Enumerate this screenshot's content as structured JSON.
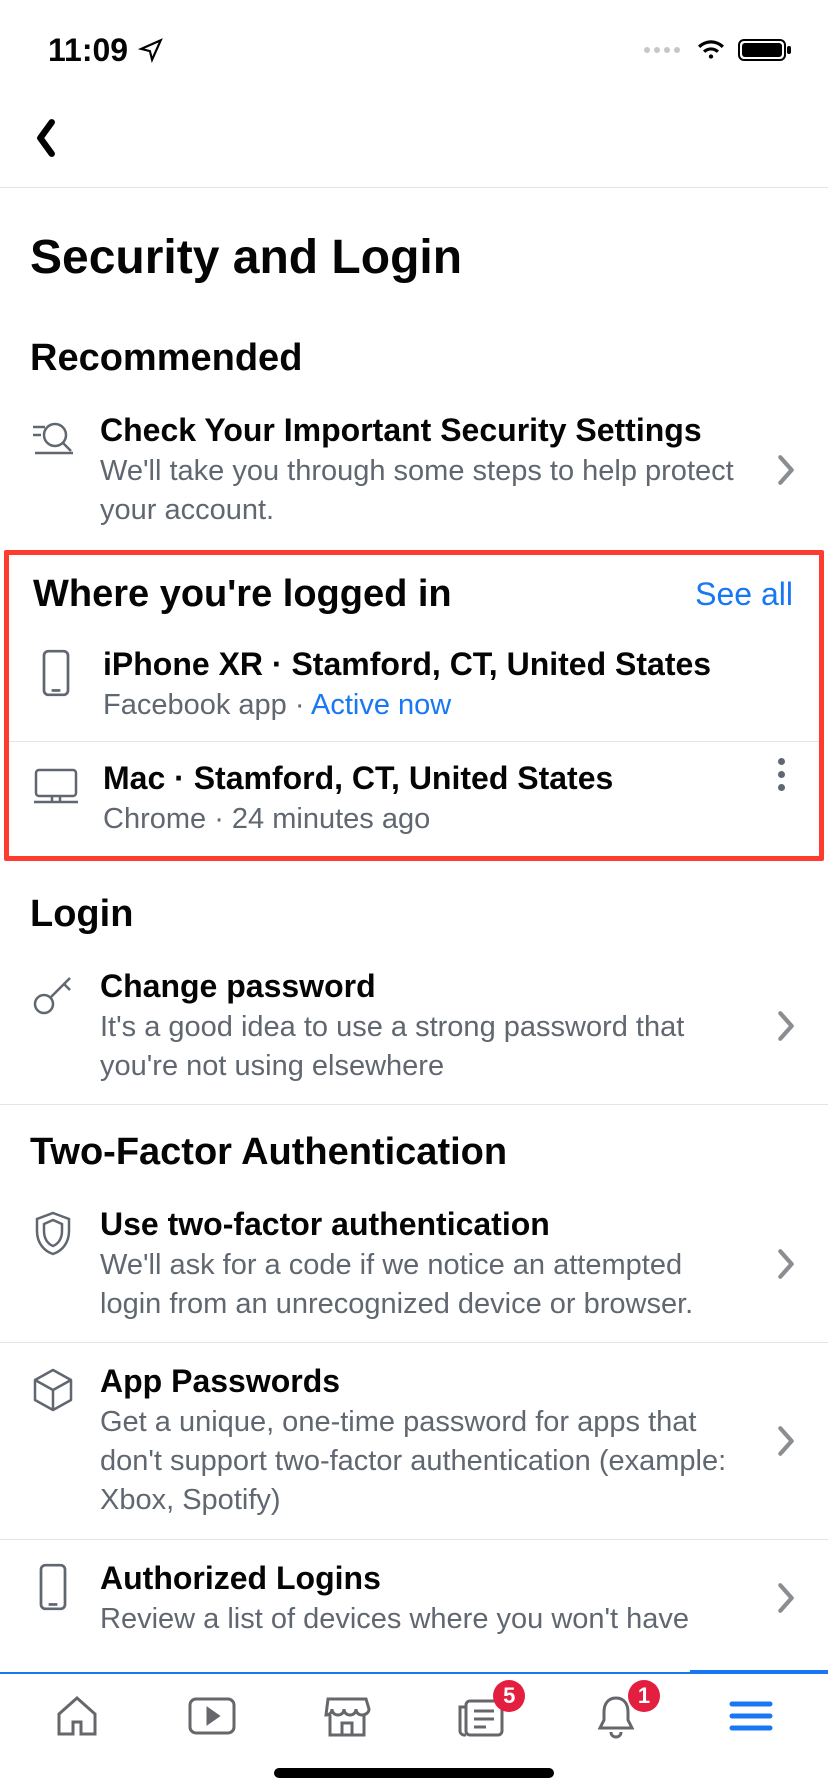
{
  "status": {
    "time": "11:09"
  },
  "page": {
    "title": "Security and Login"
  },
  "recommended": {
    "heading": "Recommended",
    "item": {
      "title": "Check Your Important Security Settings",
      "sub": "We'll take you through some steps to help protect your account."
    }
  },
  "sessions": {
    "heading": "Where you're logged in",
    "see_all": "See all",
    "items": [
      {
        "title": "iPhone XR · Stamford, CT, United States",
        "sub_prefix": "Facebook app · ",
        "sub_active": "Active now"
      },
      {
        "title": "Mac · Stamford, CT, United States",
        "sub": "Chrome · 24 minutes ago"
      }
    ]
  },
  "login": {
    "heading": "Login",
    "item": {
      "title": "Change password",
      "sub": "It's a good idea to use a strong password that you're not using elsewhere"
    }
  },
  "twofa": {
    "heading": "Two-Factor Authentication",
    "items": [
      {
        "title": "Use two-factor authentication",
        "sub": "We'll ask for a code if we notice an attempted login from an unrecognized device or browser."
      },
      {
        "title": "App Passwords",
        "sub": "Get a unique, one-time password for apps that don't support two-factor authentication (example: Xbox, Spotify)"
      },
      {
        "title": "Authorized Logins",
        "sub": "Review a list of devices where you won't have"
      }
    ]
  },
  "tabs": {
    "news_badge": "5",
    "notif_badge": "1"
  }
}
